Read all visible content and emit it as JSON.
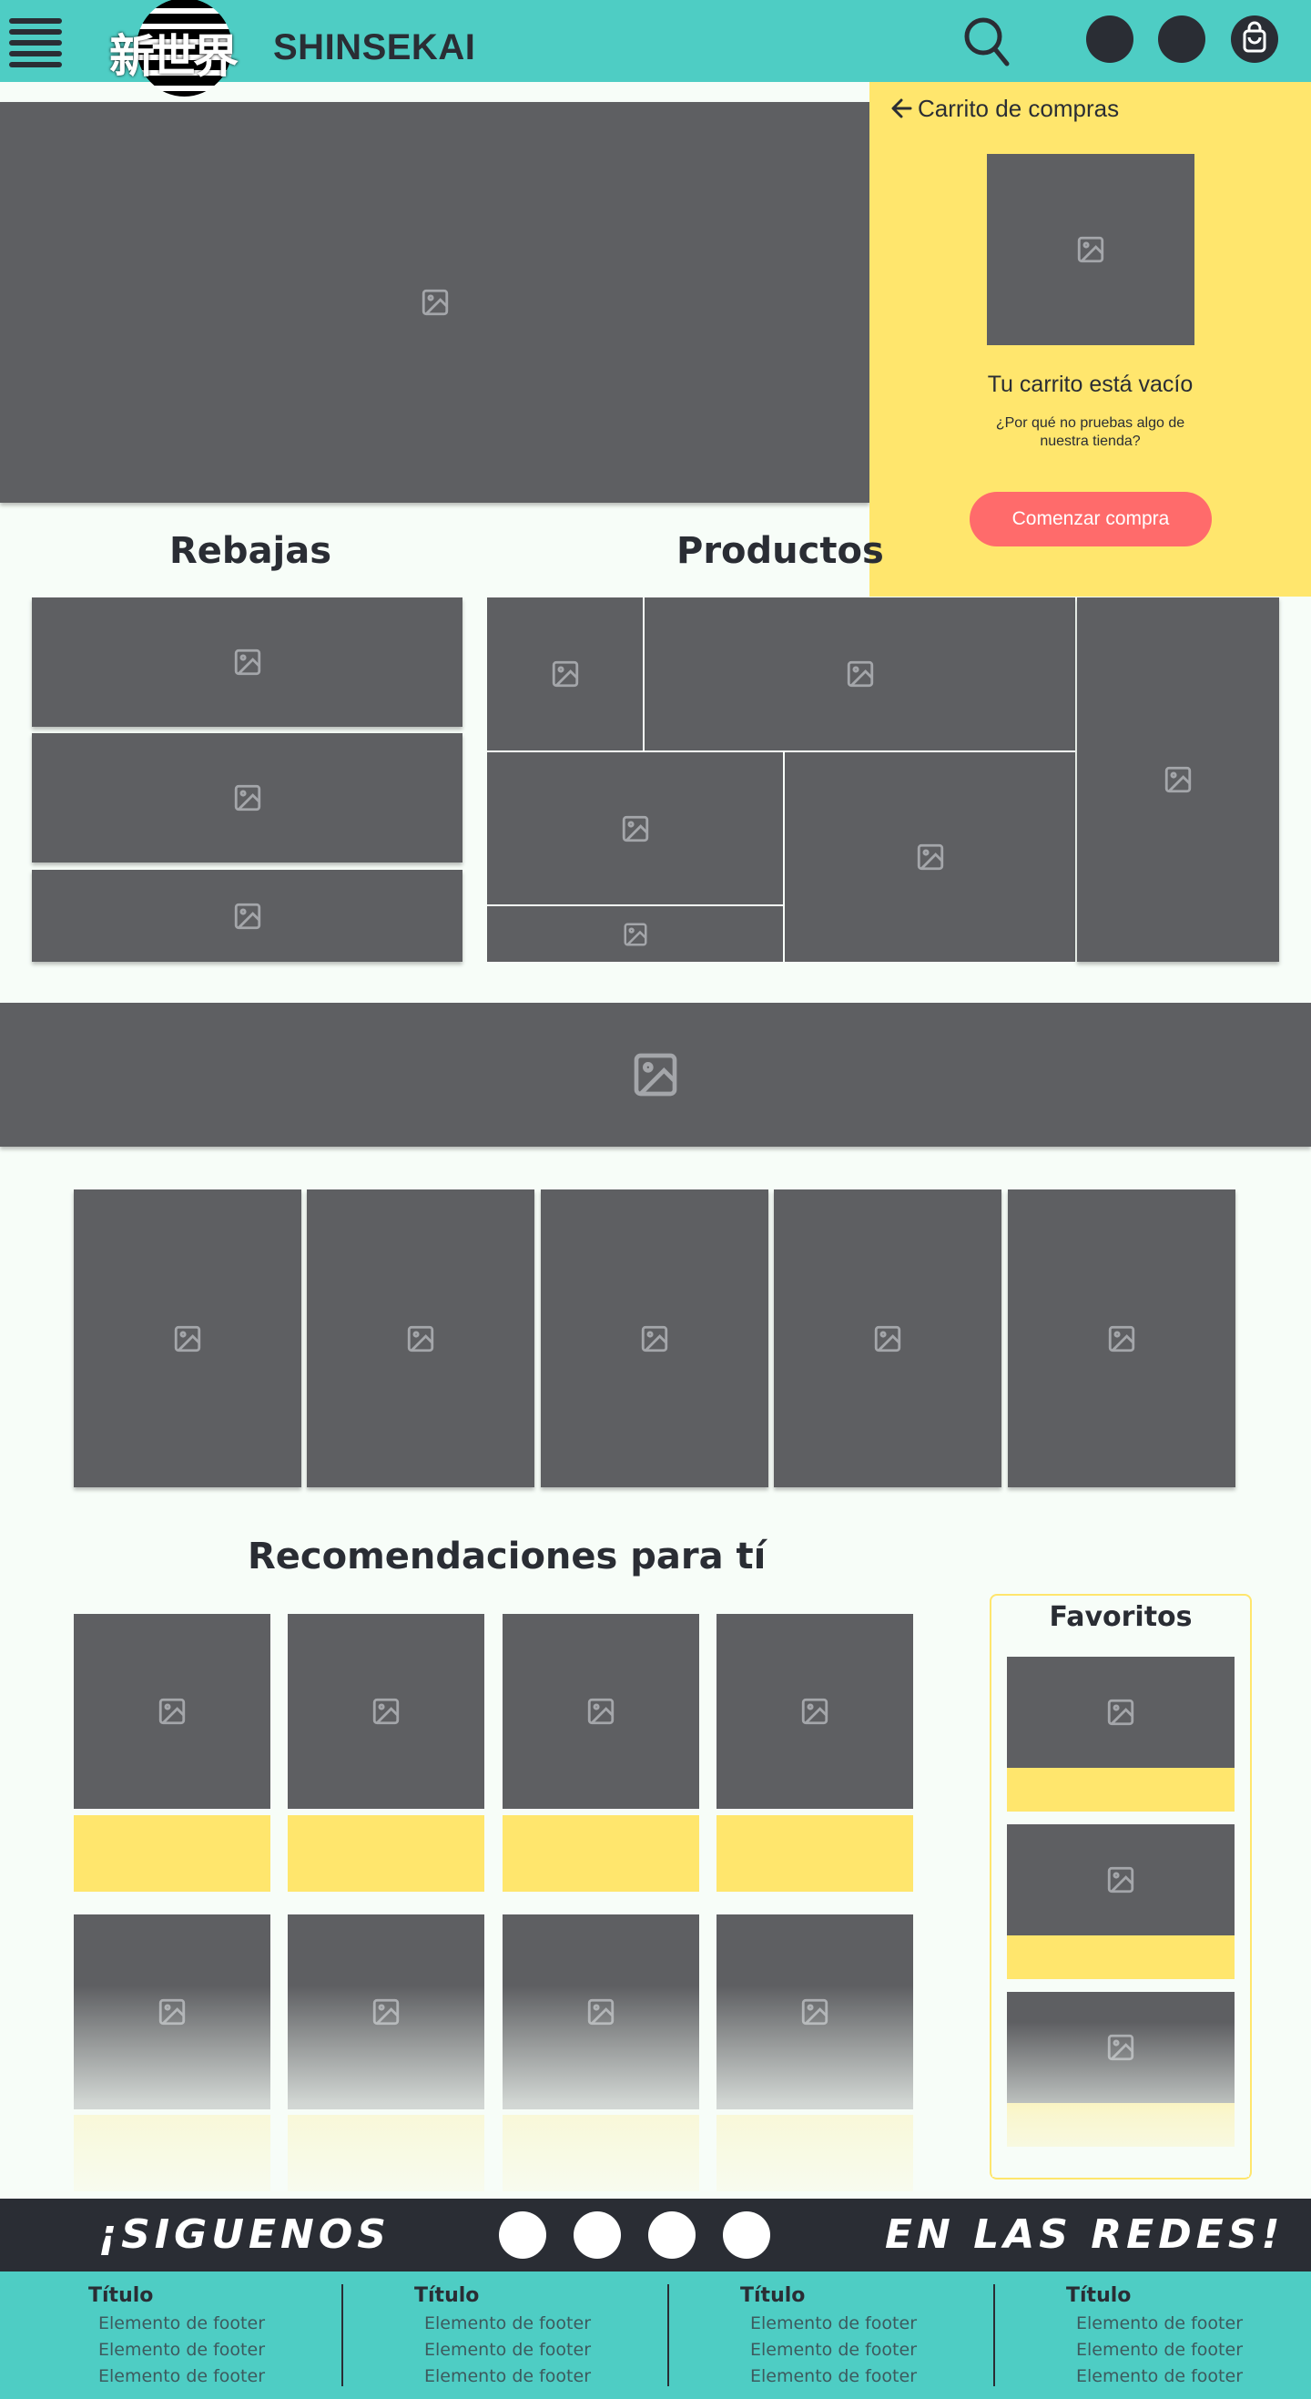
{
  "header": {
    "logo_text": "新世界",
    "brand": "SHINSEKAI",
    "icons": [
      "menu-icon",
      "search-icon",
      "cart-icon"
    ]
  },
  "cart": {
    "title": "Carrito de compras",
    "empty_title": "Tu carrito está vacío",
    "empty_sub": "¿Por qué no pruebas algo de nuestra tienda?",
    "button": "Comenzar compra"
  },
  "sections": {
    "sales": "Rebajas",
    "products": "Productos",
    "recommendations": "Recomendaciones para tí",
    "favorites": "Favoritos"
  },
  "follow": {
    "left": "¡SIGUENOS",
    "right": "EN LAS REDES!"
  },
  "footer": {
    "columns": [
      {
        "title": "Título",
        "items": [
          "Elemento de footer",
          "Elemento de footer",
          "Elemento de footer"
        ]
      },
      {
        "title": "Título",
        "items": [
          "Elemento de footer",
          "Elemento de footer",
          "Elemento de footer"
        ]
      },
      {
        "title": "Título",
        "items": [
          "Elemento de footer",
          "Elemento de footer",
          "Elemento de footer"
        ]
      },
      {
        "title": "Título",
        "items": [
          "Elemento de footer",
          "Elemento de footer",
          "Elemento de footer"
        ]
      }
    ]
  },
  "colors": {
    "teal": "#4ecdc4",
    "dark": "#2a2d34",
    "yellow": "#ffe66d",
    "coral": "#ff6b6b",
    "placeholder": "#5e5f62"
  }
}
